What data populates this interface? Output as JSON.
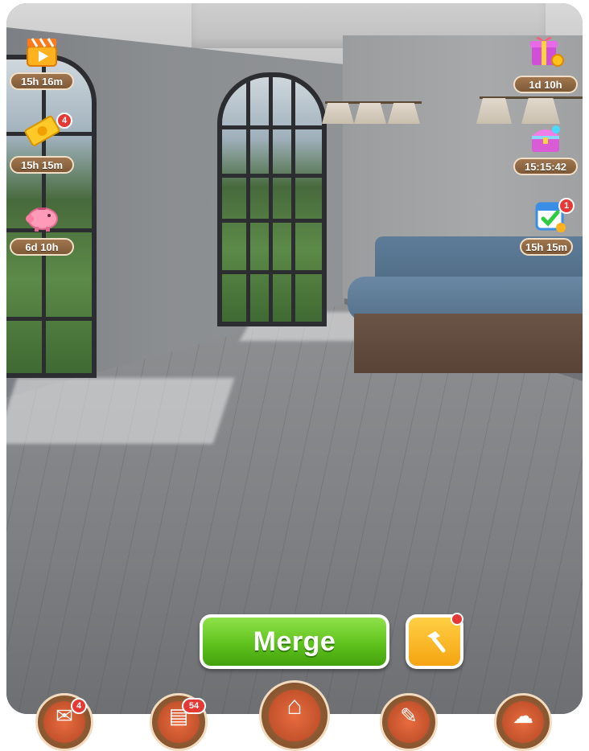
{
  "left_widgets": [
    {
      "name": "video-reward",
      "icon": "clapperboard-icon",
      "timer": "15h 16m",
      "badge": null
    },
    {
      "name": "ticket-event",
      "icon": "golden-ticket-icon",
      "timer": "15h 15m",
      "badge": "4"
    },
    {
      "name": "piggy-bank",
      "icon": "piggy-bank-icon",
      "timer": "6d 10h",
      "badge": null
    }
  ],
  "right_widgets": [
    {
      "name": "gift-offer",
      "icon": "gift-coins-icon",
      "timer": "1d 10h",
      "badge": null
    },
    {
      "name": "treasure-chest",
      "icon": "treasure-chest-icon",
      "timer": "15:15:42",
      "badge": null
    },
    {
      "name": "daily-tasks",
      "icon": "calendar-check-icon",
      "timer": "15h 15m",
      "badge": "1"
    }
  ],
  "actions": {
    "merge_label": "Merge",
    "hammer_icon": "hammer-icon"
  },
  "bottom_tabs": [
    {
      "name": "tab-1",
      "badge": "4"
    },
    {
      "name": "tab-2",
      "badge": "54"
    },
    {
      "name": "tab-home",
      "badge": null
    },
    {
      "name": "tab-4",
      "badge": null
    },
    {
      "name": "tab-5",
      "badge": null
    }
  ],
  "colors": {
    "merge_green": "#5fc21d",
    "hammer_orange": "#f5a411",
    "timer_brown": "#8f6641",
    "badge_red": "#e53935"
  }
}
